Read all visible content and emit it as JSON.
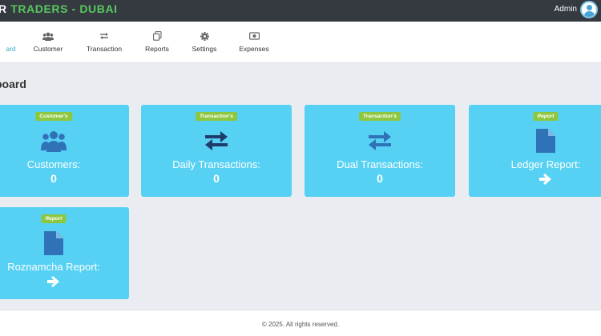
{
  "header": {
    "brand_part1": "R ",
    "brand_part2": "TRADERS - DUBAI",
    "brand_color": "#5ac85f",
    "user_label": "Admin"
  },
  "nav": {
    "active_fragment": "ard",
    "items": [
      {
        "label": "Customer",
        "icon": "users-icon"
      },
      {
        "label": "Transaction",
        "icon": "exchange-icon"
      },
      {
        "label": "Reports",
        "icon": "copy-icon"
      },
      {
        "label": "Settings",
        "icon": "gear-icon"
      },
      {
        "label": "Expenses",
        "icon": "money-bill-icon"
      }
    ]
  },
  "page": {
    "title": "board"
  },
  "cards": [
    {
      "badge": "Customer's",
      "title": "Customers:",
      "value": "0",
      "icon": "users-icon"
    },
    {
      "badge": "Transaction's",
      "title": "Daily Transactions:",
      "value": "0",
      "icon": "exchange-icon"
    },
    {
      "badge": "Transaction's",
      "title": "Dual Transactions:",
      "value": "0",
      "icon": "exchange-icon"
    },
    {
      "badge": "Report",
      "title": "Ledger Report:",
      "value": "",
      "icon": "file-icon"
    },
    {
      "badge": "Report",
      "title": "Roznamcha Report:",
      "value": "",
      "icon": "file-icon"
    }
  ],
  "footer": {
    "text": "© 2025. All rights reserved."
  },
  "colors": {
    "card_bg": "#56d1f3",
    "badge_bg": "#8dc63f",
    "topbar_bg": "#343a40"
  }
}
